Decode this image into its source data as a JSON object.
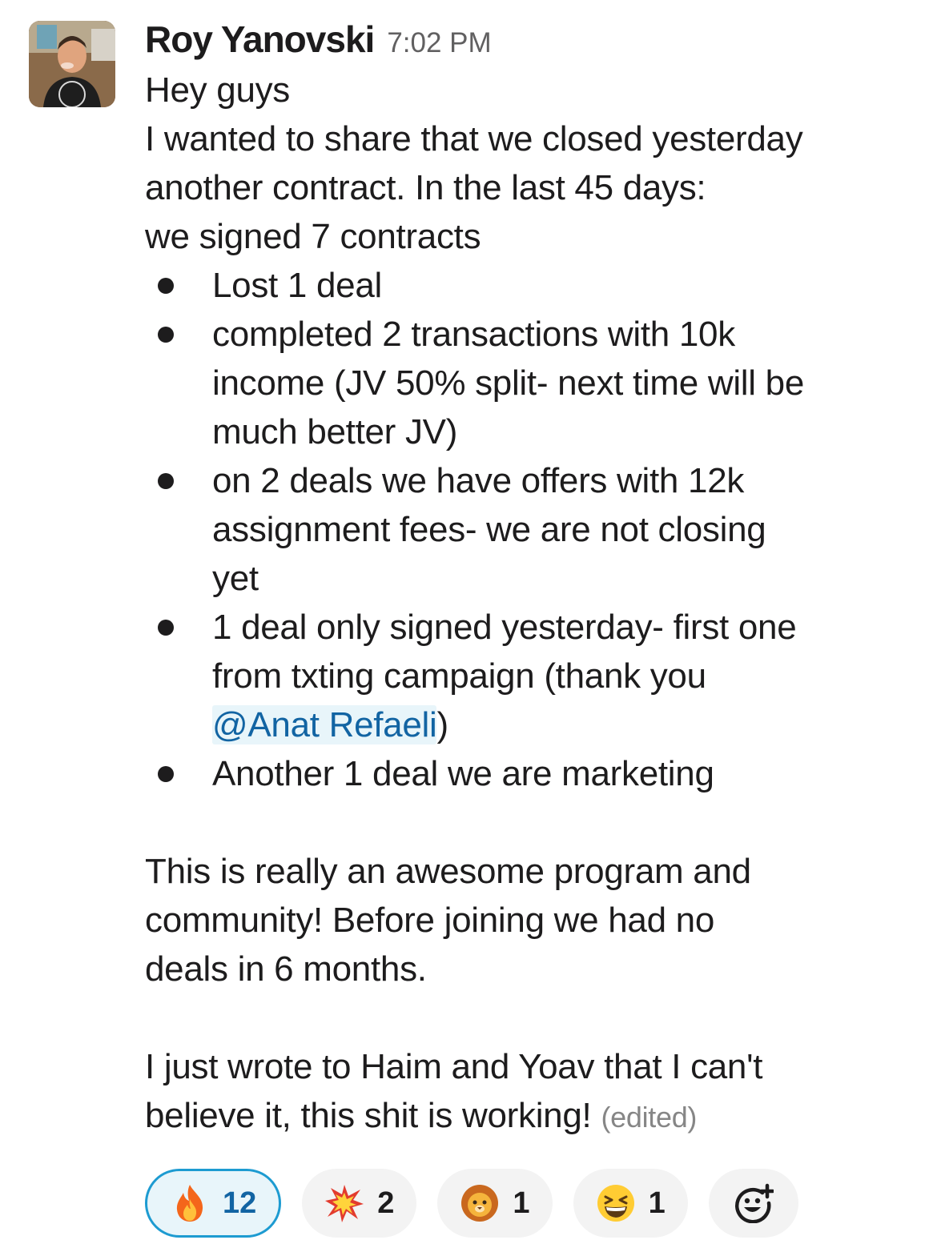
{
  "message": {
    "author": "Roy Yanovski",
    "time": "7:02 PM",
    "intro_lines": [
      "Hey guys",
      "I wanted to share that we closed yesterday",
      "another contract. In the last 45 days:",
      "we signed 7 contracts"
    ],
    "bullets": [
      {
        "lines": [
          "Lost 1 deal"
        ]
      },
      {
        "lines": [
          "completed 2 transactions with 10k",
          "income (JV 50% split- next time will be",
          "much better JV)"
        ]
      },
      {
        "lines": [
          "on 2 deals we have offers with 12k",
          "assignment fees- we are not closing",
          "yet"
        ]
      },
      {
        "lines": [
          "1 deal only signed yesterday- first one",
          "from txting campaign (thank you"
        ],
        "mention": "@Anat Refaeli",
        "mention_suffix": ")"
      },
      {
        "lines": [
          "Another 1 deal we are marketing"
        ]
      }
    ],
    "paragraph2_lines": [
      "This is really an awesome program and",
      "community! Before joining we had no",
      "deals in 6 months."
    ],
    "paragraph3_lines": [
      "I just wrote to Haim and Yoav that I can't",
      "believe it, this shit is working!"
    ],
    "edited_label": "(edited)"
  },
  "reactions": [
    {
      "emoji": "fire-emoji",
      "count": "12",
      "active": true
    },
    {
      "emoji": "collision-emoji",
      "count": "2",
      "active": false
    },
    {
      "emoji": "lion-emoji",
      "count": "1",
      "active": false
    },
    {
      "emoji": "grinning-squinting-face-emoji",
      "count": "1",
      "active": false
    }
  ],
  "add_reaction_icon": "add-reaction-icon",
  "colors": {
    "mention_text": "#1264a3",
    "mention_bg": "#e8f5fa",
    "active_reaction_border": "#1d9bd1",
    "reaction_bg": "#f3f3f3"
  }
}
